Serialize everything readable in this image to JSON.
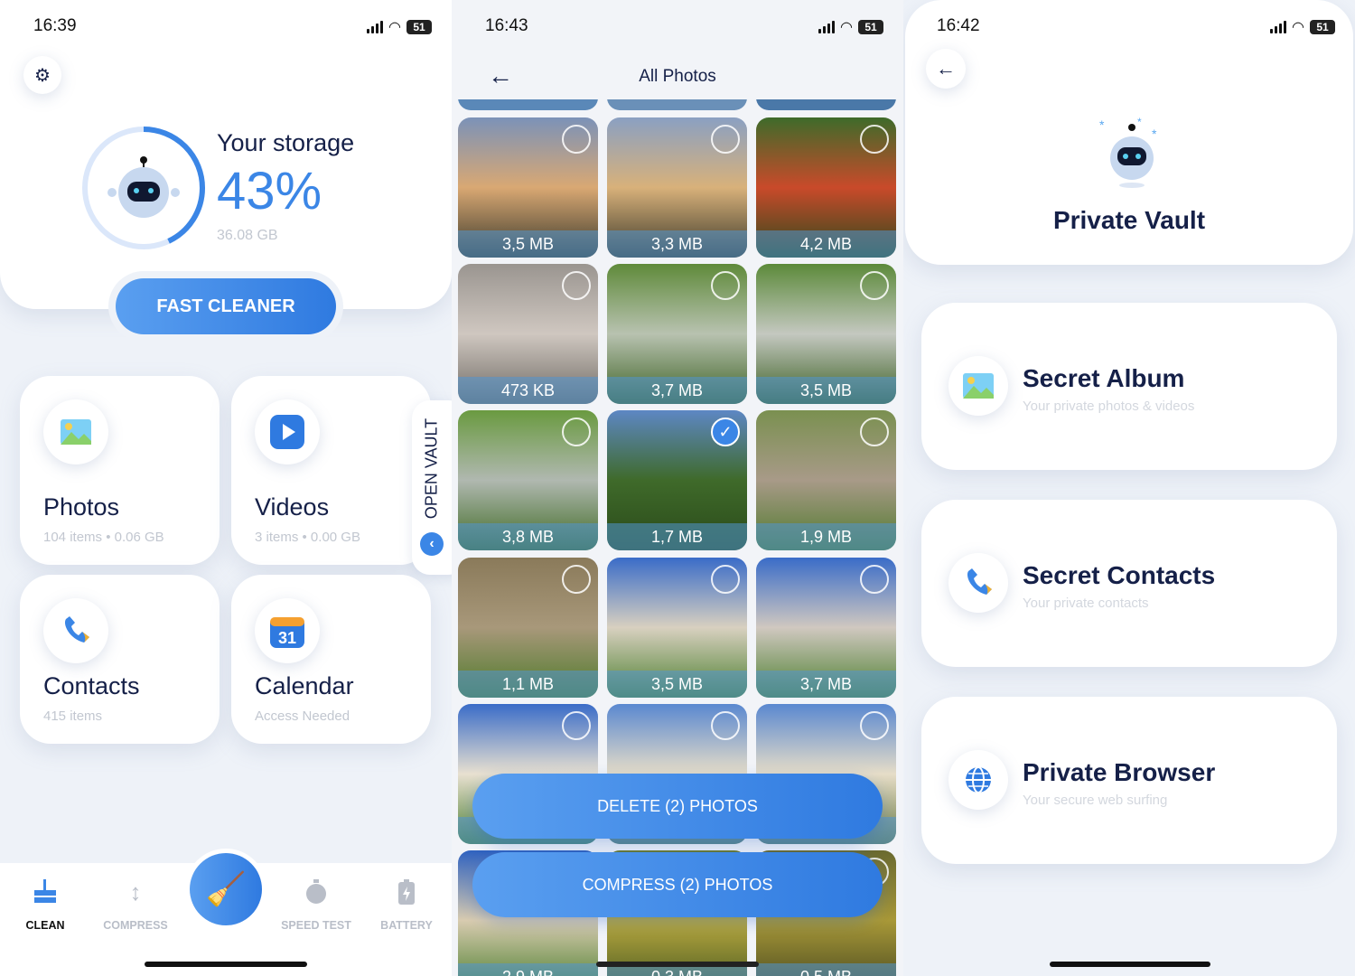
{
  "screen1": {
    "status": {
      "time": "16:39",
      "battery": "51"
    },
    "storage": {
      "title": "Your storage",
      "percent": "43%",
      "percent_value": 43,
      "used": "36.08  GB"
    },
    "fast_cleaner": "FAST CLEANER",
    "tiles": [
      {
        "title": "Photos",
        "sub": "104 items • 0.06 GB",
        "icon": "photo-icon"
      },
      {
        "title": "Videos",
        "sub": "3 items • 0.00 GB",
        "icon": "play-icon"
      },
      {
        "title": "Contacts",
        "sub": "415 items",
        "icon": "phone-icon"
      },
      {
        "title": "Calendar",
        "sub": "Access Needed",
        "icon": "calendar-icon",
        "icon_text": "31"
      }
    ],
    "open_vault": "OPEN VAULT",
    "nav": [
      {
        "label": "CLEAN",
        "active": true
      },
      {
        "label": "COMPRESS"
      },
      {
        "label": "SPEED TEST"
      },
      {
        "label": "BATTERY"
      }
    ],
    "accent": "#3b86e6"
  },
  "screen2": {
    "status": {
      "time": "16:43",
      "battery": "51"
    },
    "title": "All Photos",
    "photos": [
      {
        "size": "3,5 MB",
        "tint": [
          "#7b92b8",
          "#d9a873",
          "#3b3a2c"
        ]
      },
      {
        "size": "3,3 MB",
        "tint": [
          "#8aa0c2",
          "#d8b17a",
          "#3d3a2b"
        ]
      },
      {
        "size": "4,2 MB",
        "tint": [
          "#3e6b2a",
          "#c94a2a",
          "#2c4a1c"
        ]
      },
      {
        "size": "473 KB",
        "tint": [
          "#9a9590",
          "#cfc7c0",
          "#6f6a64"
        ]
      },
      {
        "size": "3,7 MB",
        "tint": [
          "#5f8a3a",
          "#b8c2b0",
          "#3d6224"
        ]
      },
      {
        "size": "3,5 MB",
        "tint": [
          "#5c8a3a",
          "#c4c8c0",
          "#3a5f22"
        ]
      },
      {
        "size": "3,8 MB",
        "tint": [
          "#6a9a40",
          "#b0b8b0",
          "#3f6a24"
        ]
      },
      {
        "size": "1,7 MB",
        "tint": [
          "#5d87c4",
          "#3f6a2a",
          "#2a4a1a"
        ],
        "selected": true
      },
      {
        "size": "1,9 MB",
        "tint": [
          "#7a9050",
          "#a89a88",
          "#4f7a2c"
        ]
      },
      {
        "size": "1,1 MB",
        "tint": [
          "#8a7a5a",
          "#a8987a",
          "#4d7a2a"
        ]
      },
      {
        "size": "3,5 MB",
        "tint": [
          "#3a6cc8",
          "#d8d0c0",
          "#4d8030"
        ]
      },
      {
        "size": "3,7 MB",
        "tint": [
          "#3a6cc8",
          "#d0c8c0",
          "#4d8030"
        ]
      },
      {
        "size": "2,9 MB",
        "tint": [
          "#3a6cc8",
          "#e8e0d0",
          "#4d8030"
        ]
      },
      {
        "size": "0,3 MB",
        "tint": [
          "#5a88d0",
          "#e6ddc8",
          "#6a7a40"
        ]
      },
      {
        "size": "0,5 MB",
        "tint": [
          "#5a88d0",
          "#e6ddc8",
          "#6a7a40"
        ]
      },
      {
        "size": "2,9 MB",
        "tint": [
          "#2f62c0",
          "#d8cbb0",
          "#4d8030"
        ]
      },
      {
        "size": "0,3 MB",
        "tint": [
          "#6a7a30",
          "#b8a840",
          "#4a5a20"
        ]
      },
      {
        "size": "0,5 MB",
        "tint": [
          "#6a6a30",
          "#a89838",
          "#4a4a20"
        ]
      }
    ],
    "delete_btn": "DELETE (2) PHOTOS",
    "compress_btn": "COMPRESS (2) PHOTOS"
  },
  "screen3": {
    "status": {
      "time": "16:42",
      "battery": "51"
    },
    "title": "Private Vault",
    "items": [
      {
        "title": "Secret Album",
        "sub": "Your private photos & videos",
        "icon": "photo-icon"
      },
      {
        "title": "Secret Contacts",
        "sub": "Your private contacts",
        "icon": "phone-icon"
      },
      {
        "title": "Private Browser",
        "sub": "Your secure web surfing",
        "icon": "globe-icon"
      }
    ]
  }
}
